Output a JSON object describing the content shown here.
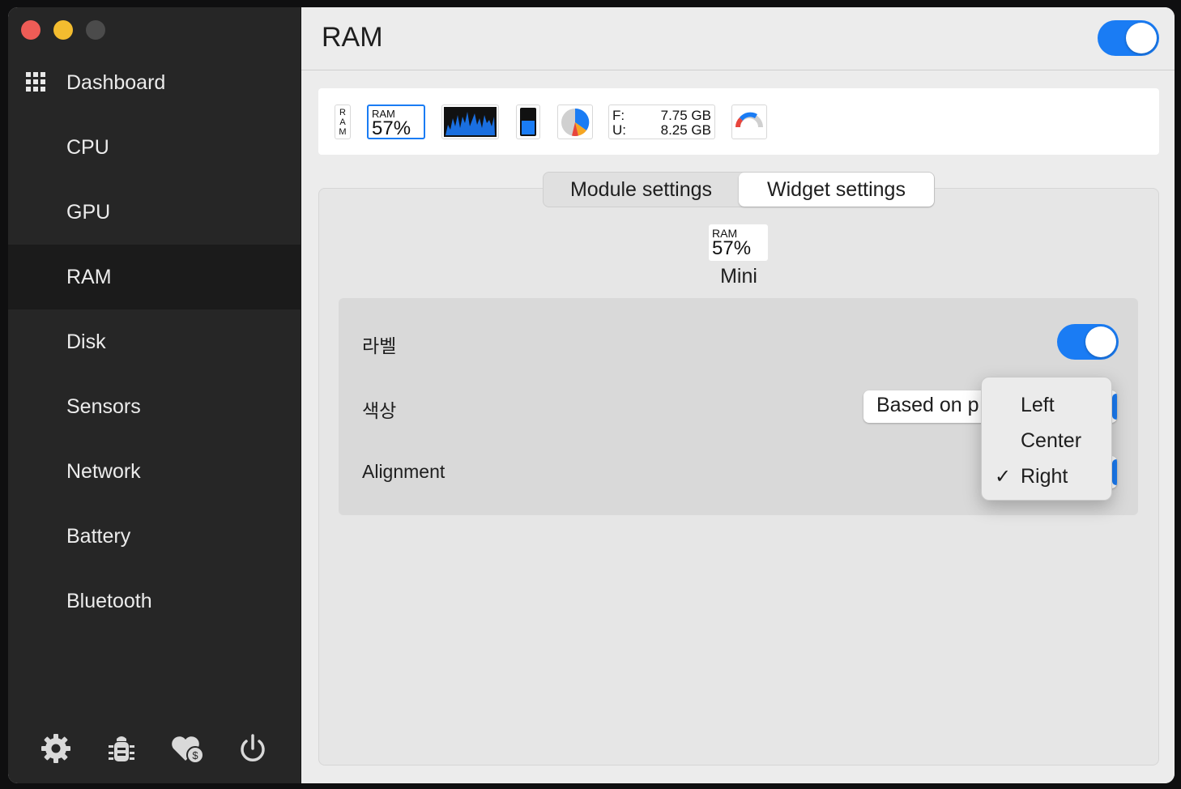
{
  "window": {
    "sidebar": {
      "items": [
        {
          "label": "Dashboard"
        },
        {
          "label": "CPU"
        },
        {
          "label": "GPU"
        },
        {
          "label": "RAM",
          "active": true
        },
        {
          "label": "Disk"
        },
        {
          "label": "Sensors"
        },
        {
          "label": "Network"
        },
        {
          "label": "Battery"
        },
        {
          "label": "Bluetooth"
        }
      ],
      "bottom_icons": [
        "gear-icon",
        "bug-icon",
        "donate-heart-icon",
        "power-icon"
      ]
    },
    "header": {
      "title": "RAM",
      "module_enabled": true
    },
    "widgets": {
      "label_widget_text": "R\nA\nM",
      "mini_widget": {
        "label": "RAM",
        "value": "57%"
      },
      "speed_widget": {
        "free_label": "F:",
        "free_value": "7.75 GB",
        "used_label": "U:",
        "used_value": "8.25 GB"
      }
    },
    "tabs": [
      {
        "label": "Module settings",
        "active": false
      },
      {
        "label": "Widget settings",
        "active": true
      }
    ],
    "preview": {
      "label": "RAM",
      "value": "57%",
      "name": "Mini"
    },
    "settings": {
      "label_row": {
        "title": "라벨",
        "enabled": true
      },
      "color_row": {
        "title": "색상",
        "value": "Based on p"
      },
      "alignment_row": {
        "title": "Alignment"
      }
    },
    "alignment_menu": {
      "options": [
        "Left",
        "Center",
        "Right"
      ],
      "selected": "Right",
      "check_mark": "✓"
    },
    "colors": {
      "accent": "#1a7cf4",
      "sidebar_bg": "#262626",
      "sidebar_active": "#1b1b1b",
      "content_bg": "#ececec"
    }
  }
}
